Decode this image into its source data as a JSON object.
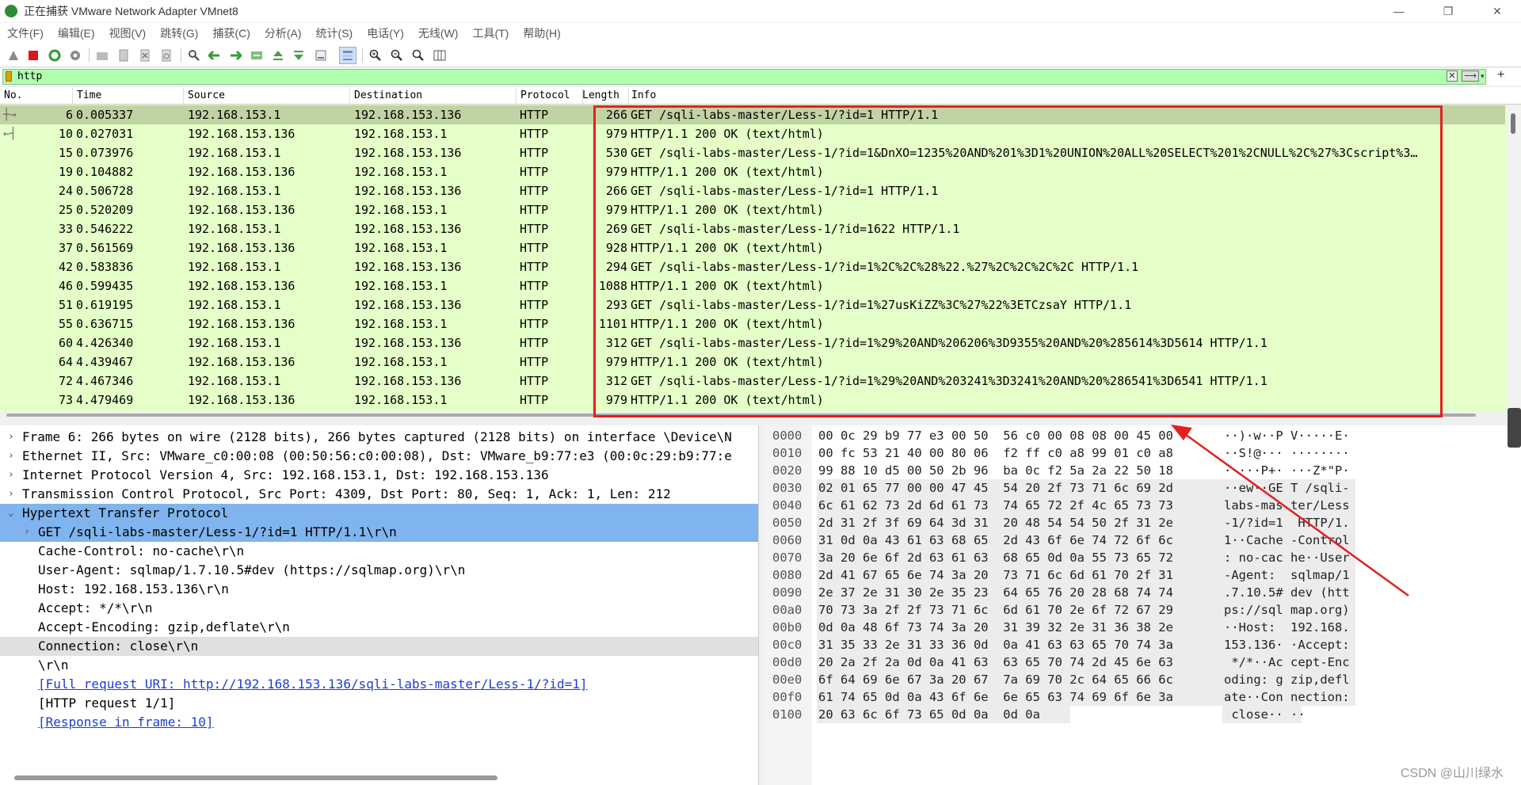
{
  "window": {
    "title": "正在捕获 VMware Network Adapter VMnet8",
    "minimize": "—",
    "maximize": "❐",
    "close": "✕"
  },
  "menu": [
    "文件(F)",
    "编辑(E)",
    "视图(V)",
    "跳转(G)",
    "捕获(C)",
    "分析(A)",
    "统计(S)",
    "电话(Y)",
    "无线(W)",
    "工具(T)",
    "帮助(H)"
  ],
  "toolbar": {
    "icons": [
      "shark-start-icon",
      "stop-icon",
      "restart-icon",
      "options-icon",
      "open-icon",
      "save-icon",
      "close-file-icon",
      "reload-icon",
      "find-icon",
      "back-icon",
      "forward-icon",
      "goto-icon",
      "first-icon",
      "last-icon",
      "autoscroll-icon",
      "colorize-icon",
      "zoom-in-icon",
      "zoom-out-icon",
      "zoom-reset-icon",
      "resize-columns-icon"
    ]
  },
  "filter": {
    "value": "http",
    "clear": "✕",
    "apply": "⟶",
    "dropdown": "▾",
    "add": "+"
  },
  "packet_list": {
    "columns": [
      "No.",
      "Time",
      "Source",
      "Destination",
      "Protocol",
      "Length",
      "Info"
    ],
    "rows": [
      {
        "no": "6",
        "time": "0.005337",
        "src": "192.168.153.1",
        "dst": "192.168.153.136",
        "proto": "HTTP",
        "len": "266",
        "info": "GET /sqli-labs-master/Less-1/?id=1 HTTP/1.1"
      },
      {
        "no": "10",
        "time": "0.027031",
        "src": "192.168.153.136",
        "dst": "192.168.153.1",
        "proto": "HTTP",
        "len": "979",
        "info": "HTTP/1.1 200 OK  (text/html)"
      },
      {
        "no": "15",
        "time": "0.073976",
        "src": "192.168.153.1",
        "dst": "192.168.153.136",
        "proto": "HTTP",
        "len": "530",
        "info": "GET /sqli-labs-master/Less-1/?id=1&DnXO=1235%20AND%201%3D1%20UNION%20ALL%20SELECT%201%2CNULL%2C%27%3Cscript%3…"
      },
      {
        "no": "19",
        "time": "0.104882",
        "src": "192.168.153.136",
        "dst": "192.168.153.1",
        "proto": "HTTP",
        "len": "979",
        "info": "HTTP/1.1 200 OK  (text/html)"
      },
      {
        "no": "24",
        "time": "0.506728",
        "src": "192.168.153.1",
        "dst": "192.168.153.136",
        "proto": "HTTP",
        "len": "266",
        "info": "GET /sqli-labs-master/Less-1/?id=1 HTTP/1.1"
      },
      {
        "no": "25",
        "time": "0.520209",
        "src": "192.168.153.136",
        "dst": "192.168.153.1",
        "proto": "HTTP",
        "len": "979",
        "info": "HTTP/1.1 200 OK  (text/html)"
      },
      {
        "no": "33",
        "time": "0.546222",
        "src": "192.168.153.1",
        "dst": "192.168.153.136",
        "proto": "HTTP",
        "len": "269",
        "info": "GET /sqli-labs-master/Less-1/?id=1622 HTTP/1.1"
      },
      {
        "no": "37",
        "time": "0.561569",
        "src": "192.168.153.136",
        "dst": "192.168.153.1",
        "proto": "HTTP",
        "len": "928",
        "info": "HTTP/1.1 200 OK  (text/html)"
      },
      {
        "no": "42",
        "time": "0.583836",
        "src": "192.168.153.1",
        "dst": "192.168.153.136",
        "proto": "HTTP",
        "len": "294",
        "info": "GET /sqli-labs-master/Less-1/?id=1%2C%2C%28%22.%27%2C%2C%2C%2C HTTP/1.1"
      },
      {
        "no": "46",
        "time": "0.599435",
        "src": "192.168.153.136",
        "dst": "192.168.153.1",
        "proto": "HTTP",
        "len": "1088",
        "info": "HTTP/1.1 200 OK  (text/html)"
      },
      {
        "no": "51",
        "time": "0.619195",
        "src": "192.168.153.1",
        "dst": "192.168.153.136",
        "proto": "HTTP",
        "len": "293",
        "info": "GET /sqli-labs-master/Less-1/?id=1%27usKiZZ%3C%27%22%3ETCzsaY HTTP/1.1"
      },
      {
        "no": "55",
        "time": "0.636715",
        "src": "192.168.153.136",
        "dst": "192.168.153.1",
        "proto": "HTTP",
        "len": "1101",
        "info": "HTTP/1.1 200 OK  (text/html)"
      },
      {
        "no": "60",
        "time": "4.426340",
        "src": "192.168.153.1",
        "dst": "192.168.153.136",
        "proto": "HTTP",
        "len": "312",
        "info": "GET /sqli-labs-master/Less-1/?id=1%29%20AND%206206%3D9355%20AND%20%285614%3D5614 HTTP/1.1"
      },
      {
        "no": "64",
        "time": "4.439467",
        "src": "192.168.153.136",
        "dst": "192.168.153.1",
        "proto": "HTTP",
        "len": "979",
        "info": "HTTP/1.1 200 OK  (text/html)"
      },
      {
        "no": "72",
        "time": "4.467346",
        "src": "192.168.153.1",
        "dst": "192.168.153.136",
        "proto": "HTTP",
        "len": "312",
        "info": "GET /sqli-labs-master/Less-1/?id=1%29%20AND%203241%3D3241%20AND%20%286541%3D6541 HTTP/1.1"
      },
      {
        "no": "73",
        "time": "4.479469",
        "src": "192.168.153.136",
        "dst": "192.168.153.1",
        "proto": "HTTP",
        "len": "979",
        "info": "HTTP/1.1 200 OK  (text/html)"
      }
    ]
  },
  "details": [
    {
      "indent": 0,
      "twisty": "›",
      "text": "Frame 6: 266 bytes on wire (2128 bits), 266 bytes captured (2128 bits) on interface \\Device\\N",
      "style": ""
    },
    {
      "indent": 0,
      "twisty": "›",
      "text": "Ethernet II, Src: VMware_c0:00:08 (00:50:56:c0:00:08), Dst: VMware_b9:77:e3 (00:0c:29:b9:77:e",
      "style": ""
    },
    {
      "indent": 0,
      "twisty": "›",
      "text": "Internet Protocol Version 4, Src: 192.168.153.1, Dst: 192.168.153.136",
      "style": ""
    },
    {
      "indent": 0,
      "twisty": "›",
      "text": "Transmission Control Protocol, Src Port: 4309, Dst Port: 80, Seq: 1, Ack: 1, Len: 212",
      "style": ""
    },
    {
      "indent": 0,
      "twisty": "⌄",
      "text": "Hypertext Transfer Protocol",
      "style": "sel"
    },
    {
      "indent": 1,
      "twisty": "›",
      "text": "GET /sqli-labs-master/Less-1/?id=1 HTTP/1.1\\r\\n",
      "style": "sel"
    },
    {
      "indent": 1,
      "twisty": "",
      "text": "Cache-Control: no-cache\\r\\n",
      "style": ""
    },
    {
      "indent": 1,
      "twisty": "",
      "text": "User-Agent: sqlmap/1.7.10.5#dev (https://sqlmap.org)\\r\\n",
      "style": ""
    },
    {
      "indent": 1,
      "twisty": "",
      "text": "Host: 192.168.153.136\\r\\n",
      "style": ""
    },
    {
      "indent": 1,
      "twisty": "",
      "text": "Accept: */*\\r\\n",
      "style": ""
    },
    {
      "indent": 1,
      "twisty": "",
      "text": "Accept-Encoding: gzip,deflate\\r\\n",
      "style": ""
    },
    {
      "indent": 1,
      "twisty": "",
      "text": "Connection: close\\r\\n",
      "style": "gray"
    },
    {
      "indent": 1,
      "twisty": "",
      "text": "\\r\\n",
      "style": ""
    },
    {
      "indent": 1,
      "twisty": "",
      "text": "[Full request URI: http://192.168.153.136/sqli-labs-master/Less-1/?id=1]",
      "style": "link"
    },
    {
      "indent": 1,
      "twisty": "",
      "text": "[HTTP request 1/1]",
      "style": ""
    },
    {
      "indent": 1,
      "twisty": "",
      "text": "[Response in frame: 10]",
      "style": "link"
    }
  ],
  "hex": [
    {
      "off": "0000",
      "bytes": "00 0c 29 b9 77 e3 00 50  56 c0 00 08 08 00 45 00",
      "ascii": "··)·w··P V·····E·",
      "hl": false
    },
    {
      "off": "0010",
      "bytes": "00 fc 53 21 40 00 80 06  f2 ff c0 a8 99 01 c0 a8",
      "ascii": "··S!@··· ········",
      "hl": false
    },
    {
      "off": "0020",
      "bytes": "99 88 10 d5 00 50 2b 96  ba 0c f2 5a 2a 22 50 18",
      "ascii": "·····P+· ···Z*\"P·",
      "hl": false
    },
    {
      "off": "0030",
      "bytes": "02 01 65 77 00 00 47 45  54 20 2f 73 71 6c 69 2d",
      "ascii": "··ew··GE T /sqli-",
      "hl": true
    },
    {
      "off": "0040",
      "bytes": "6c 61 62 73 2d 6d 61 73  74 65 72 2f 4c 65 73 73",
      "ascii": "labs-mas ter/Less",
      "hl": true
    },
    {
      "off": "0050",
      "bytes": "2d 31 2f 3f 69 64 3d 31  20 48 54 54 50 2f 31 2e",
      "ascii": "-1/?id=1  HTTP/1.",
      "hl": true
    },
    {
      "off": "0060",
      "bytes": "31 0d 0a 43 61 63 68 65  2d 43 6f 6e 74 72 6f 6c",
      "ascii": "1··Cache -Control",
      "hl": true
    },
    {
      "off": "0070",
      "bytes": "3a 20 6e 6f 2d 63 61 63  68 65 0d 0a 55 73 65 72",
      "ascii": ": no-cac he··User",
      "hl": true
    },
    {
      "off": "0080",
      "bytes": "2d 41 67 65 6e 74 3a 20  73 71 6c 6d 61 70 2f 31",
      "ascii": "-Agent:  sqlmap/1",
      "hl": true
    },
    {
      "off": "0090",
      "bytes": "2e 37 2e 31 30 2e 35 23  64 65 76 20 28 68 74 74",
      "ascii": ".7.10.5# dev (htt",
      "hl": true
    },
    {
      "off": "00a0",
      "bytes": "70 73 3a 2f 2f 73 71 6c  6d 61 70 2e 6f 72 67 29",
      "ascii": "ps://sql map.org)",
      "hl": true
    },
    {
      "off": "00b0",
      "bytes": "0d 0a 48 6f 73 74 3a 20  31 39 32 2e 31 36 38 2e",
      "ascii": "··Host:  192.168.",
      "hl": true
    },
    {
      "off": "00c0",
      "bytes": "31 35 33 2e 31 33 36 0d  0a 41 63 63 65 70 74 3a",
      "ascii": "153.136· ·Accept:",
      "hl": true
    },
    {
      "off": "00d0",
      "bytes": "20 2a 2f 2a 0d 0a 41 63  63 65 70 74 2d 45 6e 63",
      "ascii": " */*··Ac cept-Enc",
      "hl": true
    },
    {
      "off": "00e0",
      "bytes": "6f 64 69 6e 67 3a 20 67  7a 69 70 2c 64 65 66 6c",
      "ascii": "oding: g zip,defl",
      "hl": true
    },
    {
      "off": "00f0",
      "bytes": "61 74 65 0d 0a 43 6f 6e  6e 65 63 74 69 6f 6e 3a",
      "ascii": "ate··Con nection:",
      "hl": true
    },
    {
      "off": "0100",
      "bytes": "20 63 6c 6f 73 65 0d 0a  0d 0a",
      "ascii": " close·· ··",
      "hl": true
    }
  ],
  "watermark": "CSDN @山川绿水",
  "colors": {
    "packet_bg": "#e4ffc7",
    "selected_row": "#c1d2a3",
    "filter_bg": "#afffaf",
    "tree_select": "#80b4ee",
    "annotation": "#e32020"
  }
}
